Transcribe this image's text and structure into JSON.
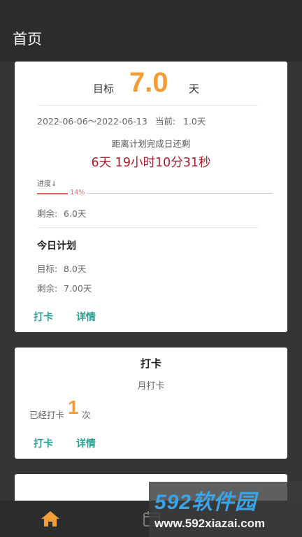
{
  "header": {
    "title": "首页"
  },
  "plan_card": {
    "goal_label": "目标",
    "goal_value": "7.0",
    "goal_unit": "天",
    "date_range": "2022-06-06～2022-06-13",
    "current_label": "当前:",
    "current_value": "1.0天",
    "remaining_title": "距离计划完成日还剩",
    "countdown": "6天 19小时10分31秒",
    "progress_label": "进度↓",
    "progress_percent": 14,
    "progress_text": "14%",
    "remaining_label": "剩余:",
    "remaining_value": "6.0天",
    "today_title": "今日计划",
    "today_goal_label": "目标:",
    "today_goal_value": "8.0天",
    "today_remaining_label": "剩余:",
    "today_remaining_value": "7.00天",
    "checkin_button": "打卡",
    "details_button": "详情"
  },
  "checkin_card": {
    "title": "打卡",
    "subtitle": "月打卡",
    "count_prefix": "已经打卡",
    "count": "1",
    "count_suffix": "次",
    "checkin_button": "打卡",
    "details_button": "详情"
  },
  "bottom_nav": {
    "items": [
      {
        "icon": "home-icon",
        "active": true
      },
      {
        "icon": "calendar-icon",
        "active": false
      }
    ]
  },
  "watermark": {
    "logo": "592软件园",
    "url": "www.592xiazai.com"
  },
  "colors": {
    "accent_orange": "#f29d38",
    "countdown_red": "#a5202b",
    "action_teal": "#2a9d8f",
    "progress_red": "#e05a5a",
    "bar_dark": "#2c2c2c",
    "background": "#353535"
  }
}
